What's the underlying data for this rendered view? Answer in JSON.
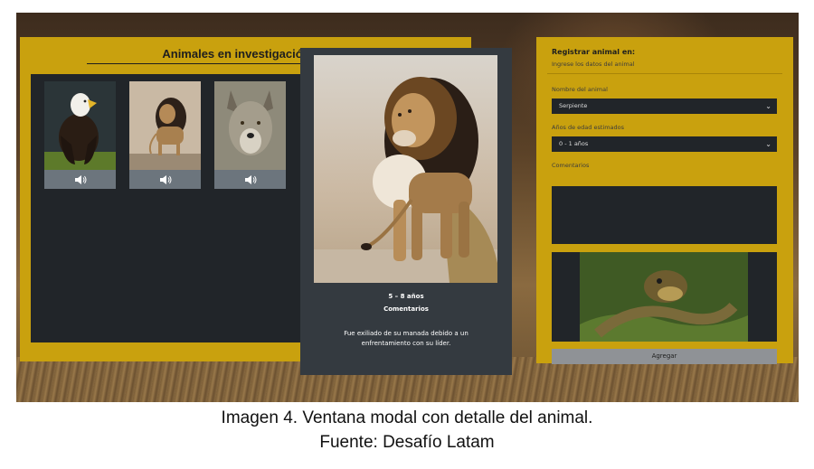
{
  "research_panel": {
    "title": "Animales en investigación",
    "cards": [
      {
        "animal": "Águila",
        "icon": "speaker-icon"
      },
      {
        "animal": "León",
        "icon": "speaker-icon"
      },
      {
        "animal": "Lobo",
        "icon": "speaker-icon"
      }
    ]
  },
  "modal": {
    "age": "5 – 8 años",
    "comments_heading": "Comentarios",
    "comment_text": "Fue exiliado de su manada debido a un enfrentamiento con su líder."
  },
  "form": {
    "title": "Registrar animal en:",
    "subtitle": "Ingrese los datos del animal",
    "name_label": "Nombre del animal",
    "name_value": "Serpiente",
    "age_label": "Años de edad estimados",
    "age_value": "0 - 1 años",
    "comments_label": "Comentarios",
    "add_button": "Agregar"
  },
  "caption": {
    "line1": "Imagen 4. Ventana modal con detalle del animal.",
    "line2": "Fuente: Desafío Latam"
  },
  "colors": {
    "panel_yellow": "#c9a10e",
    "dark": "#212529",
    "modal_bg": "#343a40",
    "audio_button": "#6c757d",
    "add_button": "#8f9296"
  }
}
